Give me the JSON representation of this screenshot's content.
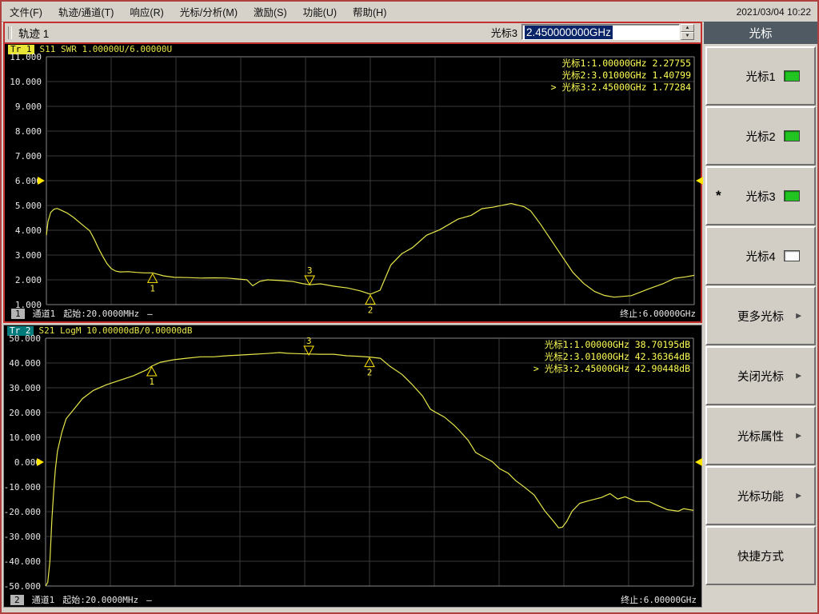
{
  "titlebar": {
    "datetime": "2021/03/04 10:22"
  },
  "menu_items": [
    "文件(F)",
    "轨迹/通道(T)",
    "响应(R)",
    "光标/分析(M)",
    "激励(S)",
    "功能(U)",
    "帮助(H)"
  ],
  "toolbar": {
    "trace_title": "轨迹 1",
    "marker_field_label": "光标3",
    "marker_field_value": "2.450000000GHz"
  },
  "sidebar": {
    "title": "光标",
    "buttons": [
      {
        "label": "光标1",
        "led": "on"
      },
      {
        "label": "光标2",
        "led": "on"
      },
      {
        "label": "光标3",
        "led": "on",
        "active_star": "*"
      },
      {
        "label": "光标4",
        "led": "off"
      },
      {
        "label": "更多光标",
        "arrow": "▶"
      },
      {
        "label": "关闭光标",
        "arrow": "▶"
      },
      {
        "label": "光标属性",
        "arrow": "▶"
      },
      {
        "label": "光标功能",
        "arrow": "▶"
      },
      {
        "label": "快捷方式"
      }
    ]
  },
  "colors": {
    "trace": "#e6e64a",
    "readout_text": "#ffff55",
    "grid": "#3a3a3a",
    "plot_border": "#8a8a8a",
    "ref_arrow": "#ffe600",
    "active_frame": "#c23030",
    "selection_bg": "#0a246a",
    "led_on": "#21c421",
    "sidebar_header_bg": "#4f5a62"
  },
  "chart_data": [
    {
      "type": "line",
      "trace_badge": "Tr 1",
      "measurement": "S11 SWR 1.00000U/6.00000U",
      "x_unit": "MHz",
      "x_range_mhz": [
        20,
        6000
      ],
      "y_range": [
        1,
        11
      ],
      "y_ticks": [
        "11.000",
        "10.000",
        "9.000",
        "8.000",
        "7.000",
        "6.000",
        "5.000",
        "4.000",
        "3.000",
        "2.000",
        "1.000"
      ],
      "ref_value": 6.0,
      "grid_divisions": 10,
      "active_prefix": ">",
      "markers": [
        {
          "n": "1",
          "freq_mhz": 1000,
          "value": 2.27755,
          "readout": "光标1:1.00000GHz 2.27755",
          "style": "below"
        },
        {
          "n": "2",
          "freq_mhz": 3010,
          "value": 1.40799,
          "readout": "光标2:3.01000GHz 1.40799",
          "style": "below"
        },
        {
          "n": "3",
          "freq_mhz": 2450,
          "value": 1.77284,
          "readout": "光标3:2.45000GHz 1.77284",
          "style": "above",
          "active": true
        }
      ],
      "status": {
        "badge": "1",
        "channel": "通道1",
        "start": "起始:20.0000MHz",
        "sweep_dash": "—",
        "stop": "终止:6.00000GHz"
      },
      "series": [
        [
          20,
          3.8
        ],
        [
          35,
          4.35
        ],
        [
          60,
          4.72
        ],
        [
          90,
          4.85
        ],
        [
          120,
          4.88
        ],
        [
          150,
          4.82
        ],
        [
          210,
          4.7
        ],
        [
          270,
          4.52
        ],
        [
          330,
          4.3
        ],
        [
          380,
          4.12
        ],
        [
          420,
          3.98
        ],
        [
          460,
          3.65
        ],
        [
          500,
          3.28
        ],
        [
          540,
          2.95
        ],
        [
          580,
          2.65
        ],
        [
          620,
          2.45
        ],
        [
          660,
          2.35
        ],
        [
          700,
          2.32
        ],
        [
          780,
          2.33
        ],
        [
          850,
          2.3
        ],
        [
          920,
          2.28
        ],
        [
          1000,
          2.28
        ],
        [
          1100,
          2.16
        ],
        [
          1200,
          2.1
        ],
        [
          1320,
          2.09
        ],
        [
          1450,
          2.07
        ],
        [
          1570,
          2.08
        ],
        [
          1690,
          2.07
        ],
        [
          1800,
          2.03
        ],
        [
          1870,
          2.0
        ],
        [
          1925,
          1.76
        ],
        [
          1990,
          1.94
        ],
        [
          2060,
          2.0
        ],
        [
          2180,
          1.97
        ],
        [
          2300,
          1.93
        ],
        [
          2380,
          1.85
        ],
        [
          2450,
          1.8
        ],
        [
          2550,
          1.84
        ],
        [
          2680,
          1.74
        ],
        [
          2800,
          1.67
        ],
        [
          2920,
          1.55
        ],
        [
          3010,
          1.42
        ],
        [
          3100,
          1.58
        ],
        [
          3200,
          2.6
        ],
        [
          3300,
          3.05
        ],
        [
          3400,
          3.3
        ],
        [
          3530,
          3.8
        ],
        [
          3650,
          4.02
        ],
        [
          3820,
          4.45
        ],
        [
          3940,
          4.6
        ],
        [
          4040,
          4.87
        ],
        [
          4140,
          4.93
        ],
        [
          4240,
          5.02
        ],
        [
          4310,
          5.08
        ],
        [
          4430,
          4.95
        ],
        [
          4490,
          4.78
        ],
        [
          4580,
          4.25
        ],
        [
          4680,
          3.6
        ],
        [
          4780,
          2.95
        ],
        [
          4880,
          2.3
        ],
        [
          4980,
          1.85
        ],
        [
          5080,
          1.53
        ],
        [
          5170,
          1.37
        ],
        [
          5260,
          1.3
        ],
        [
          5420,
          1.36
        ],
        [
          5570,
          1.62
        ],
        [
          5710,
          1.84
        ],
        [
          5820,
          2.06
        ],
        [
          5920,
          2.12
        ],
        [
          6000,
          2.18
        ]
      ]
    },
    {
      "type": "line",
      "trace_badge": "Tr 2",
      "measurement": "S21 LogM 10.00000dB/0.00000dB",
      "x_unit": "MHz",
      "x_range_mhz": [
        20,
        6000
      ],
      "y_range": [
        -50,
        50
      ],
      "y_ticks": [
        "50.000",
        "40.000",
        "30.000",
        "20.000",
        "10.000",
        "0.000",
        "-10.000",
        "-20.000",
        "-30.000",
        "-40.000",
        "-50.000"
      ],
      "ref_value": 0.0,
      "grid_divisions": 10,
      "active_prefix": ">",
      "markers": [
        {
          "n": "1",
          "freq_mhz": 1000,
          "value": 38.70195,
          "readout": "光标1:1.00000GHz 38.70195dB",
          "style": "below"
        },
        {
          "n": "2",
          "freq_mhz": 3010,
          "value": 42.36364,
          "readout": "光标2:3.01000GHz 42.36364dB",
          "style": "below"
        },
        {
          "n": "3",
          "freq_mhz": 2450,
          "value": 42.90448,
          "readout": "光标3:2.45000GHz 42.90448dB",
          "style": "above",
          "active": true
        }
      ],
      "status": {
        "badge": "2",
        "channel": "通道1",
        "start": "起始:20.0000MHz",
        "sweep_dash": "—",
        "stop": "终止:6.00000GHz"
      },
      "series": [
        [
          20,
          -50
        ],
        [
          40,
          -48.5
        ],
        [
          60,
          -40
        ],
        [
          78,
          -23
        ],
        [
          95,
          -11.5
        ],
        [
          110,
          -3
        ],
        [
          130,
          4.5
        ],
        [
          170,
          12
        ],
        [
          210,
          17.5
        ],
        [
          290,
          21.8
        ],
        [
          360,
          25.6
        ],
        [
          460,
          28.9
        ],
        [
          580,
          31.2
        ],
        [
          710,
          33.1
        ],
        [
          830,
          34.8
        ],
        [
          950,
          37.2
        ],
        [
          1000,
          38.7
        ],
        [
          1080,
          40.3
        ],
        [
          1200,
          41.3
        ],
        [
          1320,
          41.9
        ],
        [
          1450,
          42.5
        ],
        [
          1570,
          42.5
        ],
        [
          1690,
          42.9
        ],
        [
          1810,
          43.2
        ],
        [
          1940,
          43.5
        ],
        [
          2060,
          43.8
        ],
        [
          2180,
          44.2
        ],
        [
          2250,
          43.9
        ],
        [
          2310,
          43.8
        ],
        [
          2450,
          43.6
        ],
        [
          2550,
          43.5
        ],
        [
          2680,
          43.5
        ],
        [
          2800,
          42.9
        ],
        [
          2900,
          42.7
        ],
        [
          3010,
          42.4
        ],
        [
          3110,
          41.9
        ],
        [
          3200,
          38.6
        ],
        [
          3310,
          35.4
        ],
        [
          3400,
          31.5
        ],
        [
          3500,
          26.6
        ],
        [
          3570,
          21.4
        ],
        [
          3620,
          20.1
        ],
        [
          3700,
          18.2
        ],
        [
          3790,
          14.9
        ],
        [
          3840,
          12.7
        ],
        [
          3920,
          8.8
        ],
        [
          3990,
          3.9
        ],
        [
          4070,
          1.9
        ],
        [
          4140,
          0.3
        ],
        [
          4210,
          -2.6
        ],
        [
          4290,
          -4.5
        ],
        [
          4360,
          -7.5
        ],
        [
          4440,
          -10.1
        ],
        [
          4530,
          -13.3
        ],
        [
          4630,
          -19.8
        ],
        [
          4710,
          -24
        ],
        [
          4755,
          -26.5
        ],
        [
          4790,
          -26.3
        ],
        [
          4830,
          -24
        ],
        [
          4880,
          -19.8
        ],
        [
          4950,
          -16.6
        ],
        [
          5030,
          -15.6
        ],
        [
          5150,
          -14.3
        ],
        [
          5230,
          -12.7
        ],
        [
          5300,
          -14.9
        ],
        [
          5370,
          -14
        ],
        [
          5470,
          -15.9
        ],
        [
          5590,
          -15.9
        ],
        [
          5670,
          -17.5
        ],
        [
          5760,
          -19.2
        ],
        [
          5860,
          -19.8
        ],
        [
          5910,
          -18.8
        ],
        [
          6000,
          -19.5
        ]
      ]
    }
  ]
}
